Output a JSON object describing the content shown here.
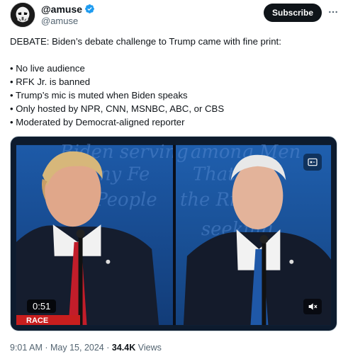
{
  "author": {
    "display_name": "@amuse",
    "handle": "@amuse",
    "avatar_icon": "stormtrooper-avatar",
    "verified_icon": "verified-badge-icon",
    "verified_color": "#1d9bf0"
  },
  "header": {
    "subscribe_label": "Subscribe",
    "more_icon": "more-dots-icon"
  },
  "tweet": {
    "headline": "DEBATE: Biden’s debate challenge to Trump came with fine print:",
    "bullets": [
      "• No live audience",
      "• RFK Jr. is banned",
      "• Trump’s mic is muted when Biden speaks",
      "• Only hosted by NPR, CNN, MSNBC, ABC, or CBS",
      "• Moderated by Democrat-aligned reporter"
    ]
  },
  "media": {
    "video_time": "0:51",
    "live_strip_text": "RACE",
    "mute_icon": "speaker-muted-icon",
    "gif_icon": "captions-icon",
    "background_color": "#1a4a8a"
  },
  "meta": {
    "time": "9:01 AM",
    "separator": "·",
    "date": "May 15, 2024",
    "views_count": "34.4K",
    "views_label": "Views"
  }
}
